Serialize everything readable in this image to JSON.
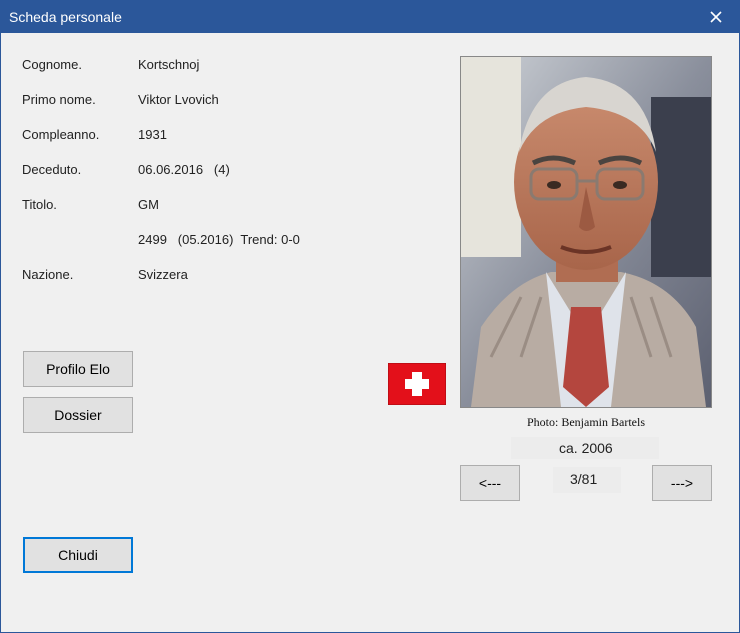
{
  "window": {
    "title": "Scheda personale"
  },
  "fields": {
    "surname_label": "Cognome.",
    "surname_value": "Kortschnoj",
    "firstname_label": "Primo nome.",
    "firstname_value": "Viktor Lvovich",
    "birthday_label": "Compleanno.",
    "birthday_value": "1931",
    "died_label": "Deceduto.",
    "died_value": "06.06.2016   (4)",
    "title_label": "Titolo.",
    "title_value": "GM",
    "elo_value": "2499   (05.2016)  Trend: 0-0",
    "nation_label": "Nazione.",
    "nation_value": "Svizzera"
  },
  "buttons": {
    "elo_profile": "Profilo Elo",
    "dossier": "Dossier",
    "close": "Chiudi",
    "prev": "<---",
    "next": "--->"
  },
  "photo": {
    "credit": "Photo: Benjamin Bartels",
    "date": "ca. 2006",
    "counter": "3/81"
  },
  "flag": {
    "country": "Switzerland",
    "icon": "swiss-flag-icon",
    "color": "#e3101a"
  },
  "colors": {
    "titlebar": "#2b579a",
    "accent": "#0078d7"
  }
}
